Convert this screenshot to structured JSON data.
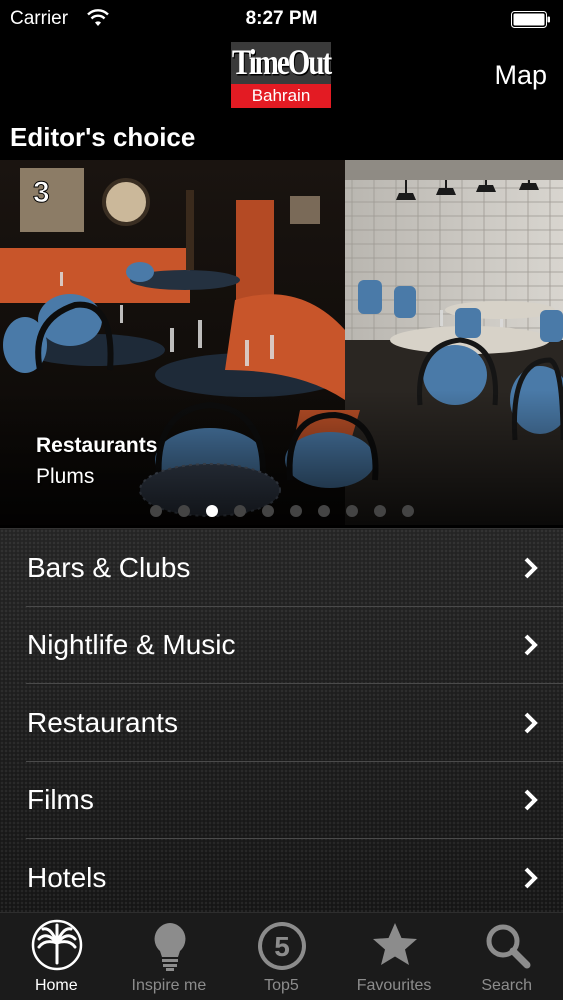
{
  "status_bar": {
    "carrier": "Carrier",
    "time": "8:27 PM"
  },
  "nav": {
    "logo_top": "TimeOut",
    "logo_bottom": "Bahrain",
    "map_label": "Map"
  },
  "section_title": "Editor's choice",
  "carousel": {
    "category": "Restaurants",
    "name": "Plums",
    "badge": "3",
    "page_count": 10,
    "active_index": 2
  },
  "categories": [
    {
      "label": "Bars & Clubs"
    },
    {
      "label": "Nightlife & Music"
    },
    {
      "label": "Restaurants"
    },
    {
      "label": "Films"
    },
    {
      "label": "Hotels"
    }
  ],
  "tabs": [
    {
      "label": "Home",
      "icon": "palm-tree-icon",
      "active": true
    },
    {
      "label": "Inspire me",
      "icon": "lightbulb-icon",
      "active": false
    },
    {
      "label": "Top5",
      "icon": "top5-badge-icon",
      "badge": "5",
      "active": false
    },
    {
      "label": "Favourites",
      "icon": "star-icon",
      "active": false
    },
    {
      "label": "Search",
      "icon": "search-icon",
      "active": false
    }
  ],
  "colors": {
    "accent_red": "#e31b23",
    "chair_blue": "#4a7aa8",
    "sofa_orange": "#c8552a"
  }
}
